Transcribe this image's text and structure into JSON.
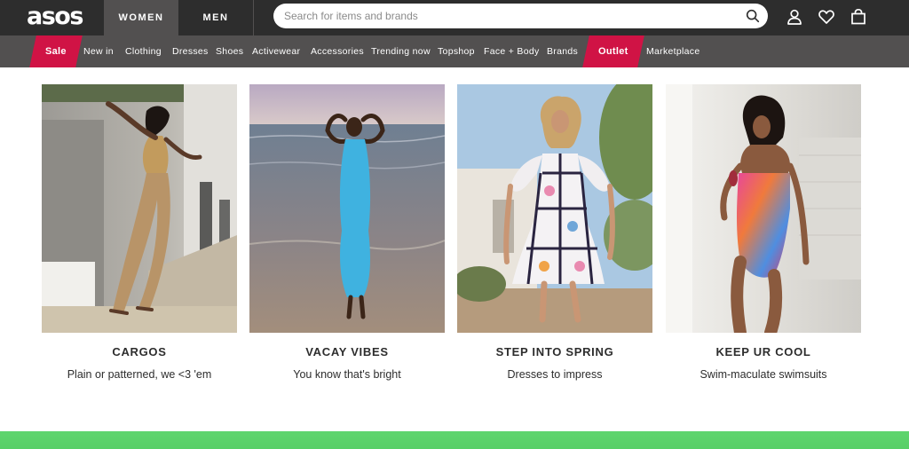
{
  "header": {
    "logo": "asos",
    "gender_tabs": [
      {
        "label": "WOMEN",
        "active": true
      },
      {
        "label": "MEN",
        "active": false
      }
    ],
    "search": {
      "placeholder": "Search for items and brands",
      "value": ""
    },
    "icons": [
      "search-icon",
      "account-icon",
      "heart-icon",
      "bag-icon"
    ]
  },
  "nav": {
    "items": [
      {
        "label": "Sale",
        "highlight": true
      },
      {
        "label": "New in"
      },
      {
        "label": "Clothing"
      },
      {
        "label": "Dresses"
      },
      {
        "label": "Shoes"
      },
      {
        "label": "Activewear"
      },
      {
        "label": "Accessories"
      },
      {
        "label": "Trending now"
      },
      {
        "label": "Topshop"
      },
      {
        "label": "Face + Body"
      },
      {
        "label": "Brands"
      },
      {
        "label": "Outlet",
        "highlight": true
      },
      {
        "label": "Marketplace"
      }
    ]
  },
  "cards": [
    {
      "title": "CARGOS",
      "subtitle": "Plain or patterned, we <3 'em"
    },
    {
      "title": "VACAY VIBES",
      "subtitle": "You know that's bright"
    },
    {
      "title": "STEP INTO SPRING",
      "subtitle": "Dresses to impress"
    },
    {
      "title": "KEEP UR COOL",
      "subtitle": "Swim-maculate swimsuits"
    }
  ],
  "colors": {
    "topbar": "#2d2d2d",
    "navbar": "#525050",
    "sale_red": "#d01345",
    "promo_green": "#5fd56e",
    "text_dark": "#2d2d2d"
  }
}
